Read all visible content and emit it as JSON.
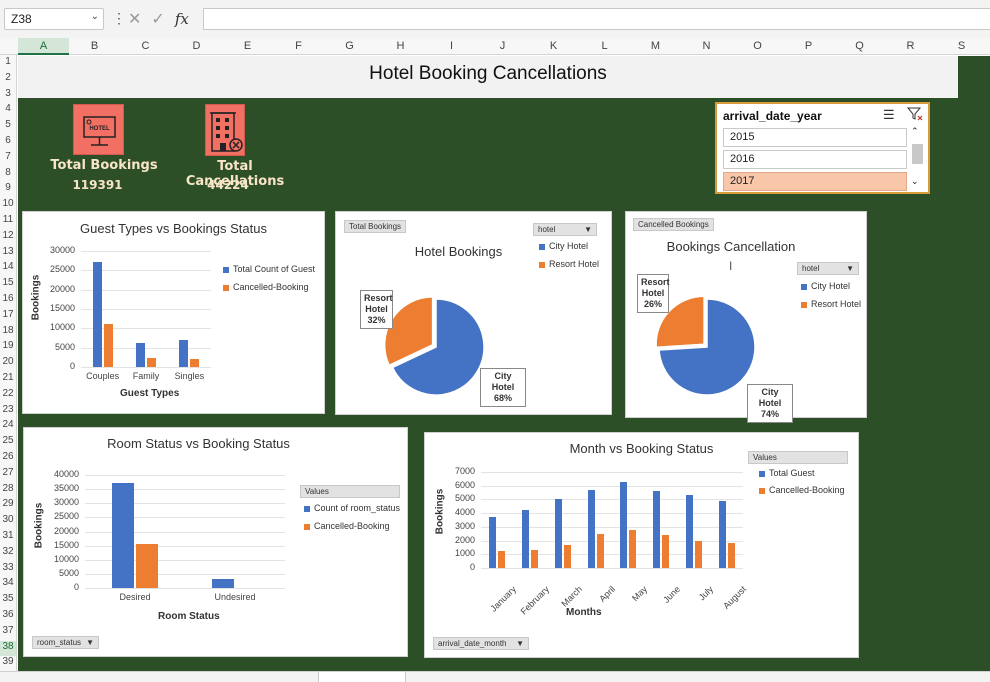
{
  "formula_bar": {
    "name_box": "Z38",
    "fx_label": "fx",
    "formula": ""
  },
  "columns": [
    "A",
    "B",
    "C",
    "D",
    "E",
    "F",
    "G",
    "H",
    "I",
    "J",
    "K",
    "L",
    "M",
    "N",
    "O",
    "P",
    "Q",
    "R",
    "S"
  ],
  "rows": [
    "1",
    "2",
    "3",
    "4",
    "5",
    "6",
    "7",
    "8",
    "9",
    "10",
    "11",
    "12",
    "13",
    "14",
    "15",
    "16",
    "17",
    "18",
    "19",
    "20",
    "21",
    "22",
    "23",
    "24",
    "25",
    "26",
    "27",
    "28",
    "29",
    "30",
    "31",
    "32",
    "33",
    "34",
    "35",
    "36",
    "37",
    "38",
    "39"
  ],
  "dashboard": {
    "title": "Hotel Booking Cancellations",
    "background_color": "#2d4f27",
    "kpis": [
      {
        "label": "Total Bookings",
        "value": "119391",
        "icon": "hotel-sign-icon"
      },
      {
        "label": "Total Cancellations",
        "value": "44224",
        "icon": "cancelled-building-icon"
      }
    ],
    "slicer": {
      "title": "arrival_date_year",
      "items": [
        {
          "label": "2015",
          "selected": false
        },
        {
          "label": "2016",
          "selected": false
        },
        {
          "label": "2017",
          "selected": true
        }
      ]
    },
    "guest_types_chart": {
      "title": "Guest Types vs Bookings Status",
      "xlabel": "Guest Types",
      "ylabel": "Bookings",
      "yticks": [
        "30000",
        "25000",
        "20000",
        "15000",
        "10000",
        "5000",
        "0"
      ],
      "legend": [
        "Total Count of Guest",
        "Cancelled-Booking"
      ]
    },
    "hotel_bookings_chart": {
      "title": "Hotel Bookings",
      "field_button": "Total Bookings",
      "filter": "hotel",
      "legend": [
        "City Hotel",
        "Resort Hotel"
      ],
      "callouts": [
        {
          "name": "Resort Hotel",
          "pct": "32%"
        },
        {
          "name": "City Hotel",
          "pct": "68%"
        }
      ]
    },
    "cancellation_chart": {
      "title": "Bookings Cancellation",
      "field_button": "Cancelled Bookings",
      "filter": "hotel",
      "legend": [
        "City Hotel",
        "Resort Hotel"
      ],
      "callouts": [
        {
          "name": "Resort Hotel",
          "pct": "26%"
        },
        {
          "name": "City Hotel",
          "pct": "74%"
        }
      ]
    },
    "room_status_chart": {
      "title": "Room Status vs Booking Status",
      "xlabel": "Room Status",
      "ylabel": "Bookings",
      "yticks": [
        "40000",
        "35000",
        "30000",
        "25000",
        "20000",
        "15000",
        "10000",
        "5000",
        "0"
      ],
      "legend_header": "Values",
      "legend": [
        "Count of room_status",
        "Cancelled-Booking"
      ],
      "field_dropdown": "room_status"
    },
    "month_chart": {
      "title": "Month vs Booking Status",
      "xlabel": "Months",
      "ylabel": "Bookings",
      "yticks": [
        "7000",
        "6000",
        "5000",
        "4000",
        "3000",
        "2000",
        "1000",
        "0"
      ],
      "legend_header": "Values",
      "legend": [
        "Total Guest",
        "Cancelled-Booking"
      ],
      "field_dropdown": "arrival_date_month"
    }
  },
  "colors": {
    "series_blue": "#4472c4",
    "series_orange": "#ed7d31",
    "kpi_icon_bg": "#f26f63",
    "kpi_text": "#f8e5c8",
    "slicer_selected": "#f8c6a9"
  },
  "chart_data": [
    {
      "type": "bar",
      "title": "Guest Types vs Bookings Status",
      "xlabel": "Guest Types",
      "ylabel": "Bookings",
      "ylim": [
        0,
        30000
      ],
      "categories": [
        "Couples",
        "Family",
        "Singles"
      ],
      "series": [
        {
          "name": "Total Count of Guest",
          "values": [
            27100,
            6100,
            7100
          ]
        },
        {
          "name": "Cancelled-Booking",
          "values": [
            11000,
            2400,
            2000
          ]
        }
      ],
      "legend": "right",
      "grid": true
    },
    {
      "type": "pie",
      "title": "Hotel Bookings",
      "categories": [
        "City Hotel",
        "Resort Hotel"
      ],
      "values": [
        68,
        32
      ],
      "legend": "top-right"
    },
    {
      "type": "pie",
      "title": "Bookings Cancellation",
      "categories": [
        "City Hotel",
        "Resort Hotel"
      ],
      "values": [
        74,
        26
      ],
      "legend": "right"
    },
    {
      "type": "bar",
      "title": "Room Status vs Booking Status",
      "xlabel": "Room Status",
      "ylabel": "Bookings",
      "ylim": [
        0,
        40000
      ],
      "categories": [
        "Desired",
        "Undesired"
      ],
      "series": [
        {
          "name": "Count of room_status",
          "values": [
            37000,
            3300
          ]
        },
        {
          "name": "Cancelled-Booking",
          "values": [
            15500,
            0
          ]
        }
      ],
      "legend": "right",
      "grid": true
    },
    {
      "type": "bar",
      "title": "Month vs Booking Status",
      "xlabel": "Months",
      "ylabel": "Bookings",
      "ylim": [
        0,
        7000
      ],
      "categories": [
        "January",
        "February",
        "March",
        "April",
        "May",
        "June",
        "July",
        "August"
      ],
      "series": [
        {
          "name": "Total Guest",
          "values": [
            3700,
            4200,
            5000,
            5700,
            6300,
            5600,
            5300,
            4900
          ]
        },
        {
          "name": "Cancelled-Booking",
          "values": [
            1250,
            1300,
            1700,
            2500,
            2800,
            2400,
            2000,
            1800
          ]
        }
      ],
      "legend": "top-right",
      "grid": true
    }
  ]
}
